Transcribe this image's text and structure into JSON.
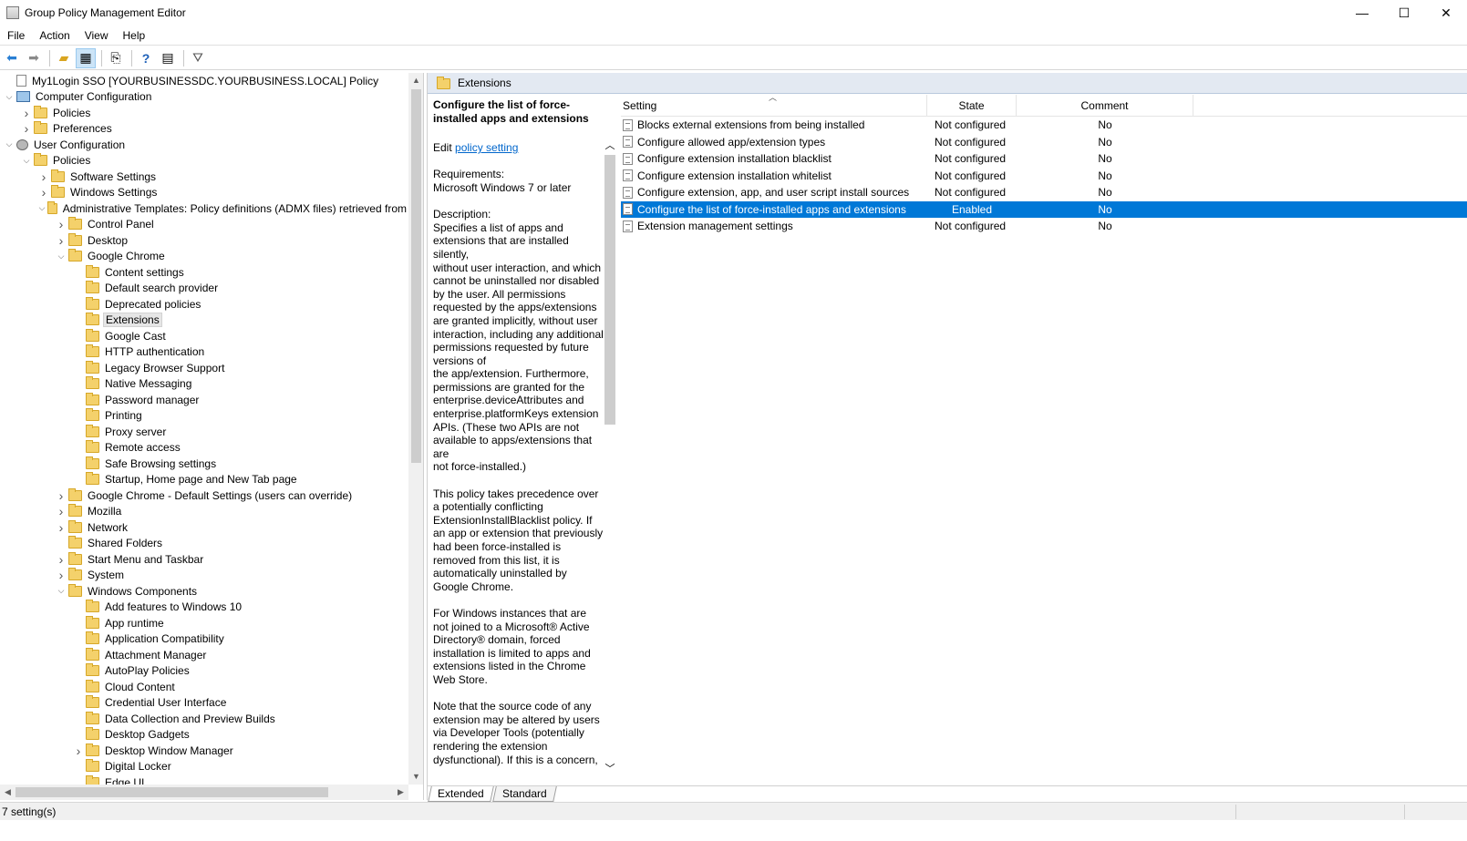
{
  "window": {
    "title": "Group Policy Management Editor",
    "minimize": "—",
    "maximize": "☐",
    "close": "✕"
  },
  "menu": [
    "File",
    "Action",
    "View",
    "Help"
  ],
  "tree": [
    {
      "depth": 0,
      "exp": "",
      "icon": "doc",
      "label": "My1Login SSO [YOURBUSINESSDC.YOURBUSINESS.LOCAL] Policy"
    },
    {
      "depth": 0,
      "exp": "down",
      "icon": "computer",
      "label": "Computer Configuration"
    },
    {
      "depth": 1,
      "exp": "right",
      "icon": "folder",
      "label": "Policies"
    },
    {
      "depth": 1,
      "exp": "right",
      "icon": "folder",
      "label": "Preferences"
    },
    {
      "depth": 0,
      "exp": "down",
      "icon": "user",
      "label": "User Configuration"
    },
    {
      "depth": 1,
      "exp": "down",
      "icon": "folder",
      "label": "Policies"
    },
    {
      "depth": 2,
      "exp": "right",
      "icon": "folder",
      "label": "Software Settings"
    },
    {
      "depth": 2,
      "exp": "right",
      "icon": "folder",
      "label": "Windows Settings"
    },
    {
      "depth": 2,
      "exp": "down",
      "icon": "folder",
      "label": "Administrative Templates: Policy definitions (ADMX files) retrieved from"
    },
    {
      "depth": 3,
      "exp": "right",
      "icon": "folder",
      "label": "Control Panel"
    },
    {
      "depth": 3,
      "exp": "right",
      "icon": "folder",
      "label": "Desktop"
    },
    {
      "depth": 3,
      "exp": "down",
      "icon": "folder",
      "label": "Google Chrome"
    },
    {
      "depth": 4,
      "exp": "",
      "icon": "folder",
      "label": "Content settings"
    },
    {
      "depth": 4,
      "exp": "",
      "icon": "folder",
      "label": "Default search provider"
    },
    {
      "depth": 4,
      "exp": "",
      "icon": "folder",
      "label": "Deprecated policies"
    },
    {
      "depth": 4,
      "exp": "",
      "icon": "folder",
      "label": "Extensions",
      "selected": true
    },
    {
      "depth": 4,
      "exp": "",
      "icon": "folder",
      "label": "Google Cast"
    },
    {
      "depth": 4,
      "exp": "",
      "icon": "folder",
      "label": "HTTP authentication"
    },
    {
      "depth": 4,
      "exp": "",
      "icon": "folder",
      "label": "Legacy Browser Support"
    },
    {
      "depth": 4,
      "exp": "",
      "icon": "folder",
      "label": "Native Messaging"
    },
    {
      "depth": 4,
      "exp": "",
      "icon": "folder",
      "label": "Password manager"
    },
    {
      "depth": 4,
      "exp": "",
      "icon": "folder",
      "label": "Printing"
    },
    {
      "depth": 4,
      "exp": "",
      "icon": "folder",
      "label": "Proxy server"
    },
    {
      "depth": 4,
      "exp": "",
      "icon": "folder",
      "label": "Remote access"
    },
    {
      "depth": 4,
      "exp": "",
      "icon": "folder",
      "label": "Safe Browsing settings"
    },
    {
      "depth": 4,
      "exp": "",
      "icon": "folder",
      "label": "Startup, Home page and New Tab page"
    },
    {
      "depth": 3,
      "exp": "right",
      "icon": "folder",
      "label": "Google Chrome - Default Settings (users can override)"
    },
    {
      "depth": 3,
      "exp": "right",
      "icon": "folder",
      "label": "Mozilla"
    },
    {
      "depth": 3,
      "exp": "right",
      "icon": "folder",
      "label": "Network"
    },
    {
      "depth": 3,
      "exp": "",
      "icon": "folder",
      "label": "Shared Folders"
    },
    {
      "depth": 3,
      "exp": "right",
      "icon": "folder",
      "label": "Start Menu and Taskbar"
    },
    {
      "depth": 3,
      "exp": "right",
      "icon": "folder",
      "label": "System"
    },
    {
      "depth": 3,
      "exp": "down",
      "icon": "folder",
      "label": "Windows Components"
    },
    {
      "depth": 4,
      "exp": "",
      "icon": "folder",
      "label": "Add features to Windows 10"
    },
    {
      "depth": 4,
      "exp": "",
      "icon": "folder",
      "label": "App runtime"
    },
    {
      "depth": 4,
      "exp": "",
      "icon": "folder",
      "label": "Application Compatibility"
    },
    {
      "depth": 4,
      "exp": "",
      "icon": "folder",
      "label": "Attachment Manager"
    },
    {
      "depth": 4,
      "exp": "",
      "icon": "folder",
      "label": "AutoPlay Policies"
    },
    {
      "depth": 4,
      "exp": "",
      "icon": "folder",
      "label": "Cloud Content"
    },
    {
      "depth": 4,
      "exp": "",
      "icon": "folder",
      "label": "Credential User Interface"
    },
    {
      "depth": 4,
      "exp": "",
      "icon": "folder",
      "label": "Data Collection and Preview Builds"
    },
    {
      "depth": 4,
      "exp": "",
      "icon": "folder",
      "label": "Desktop Gadgets"
    },
    {
      "depth": 4,
      "exp": "right",
      "icon": "folder",
      "label": "Desktop Window Manager"
    },
    {
      "depth": 4,
      "exp": "",
      "icon": "folder",
      "label": "Digital Locker"
    },
    {
      "depth": 4,
      "exp": "",
      "icon": "folder",
      "label": "Edge UI"
    }
  ],
  "right": {
    "header_title": "Extensions",
    "description": {
      "title": "Configure the list of force-installed apps and extensions",
      "edit_prefix": "Edit ",
      "edit_link": "policy setting ",
      "requirements": "Requirements:\nMicrosoft Windows 7 or later",
      "description": "Description:\nSpecifies a list of apps and extensions that are installed silently,\nwithout user interaction, and which cannot be uninstalled nor disabled by the user. All permissions requested by the apps/extensions are granted implicitly, without user interaction, including any additional permissions requested by future versions of\nthe app/extension. Furthermore, permissions are granted for the enterprise.deviceAttributes and enterprise.platformKeys extension APIs. (These two APIs are not available to apps/extensions that are\nnot force-installed.)",
      "p2": "This policy takes precedence over a potentially conflicting ExtensionInstallBlacklist policy. If an app or extension that previously had been force-installed is removed from this list, it is automatically uninstalled by Google Chrome.",
      "p3": "For Windows instances that are not joined to a Microsoft® Active Directory® domain, forced installation is limited to apps and extensions listed in the Chrome Web Store.",
      "p4": "Note that the source code of any extension may be altered by users via Developer Tools (potentially rendering the extension dysfunctional). If this is a concern,"
    },
    "columns": {
      "setting": "Setting",
      "state": "State",
      "comment": "Comment"
    },
    "rows": [
      {
        "setting": "Blocks external extensions from being installed",
        "state": "Not configured",
        "comment": "No"
      },
      {
        "setting": "Configure allowed app/extension types",
        "state": "Not configured",
        "comment": "No"
      },
      {
        "setting": "Configure extension installation blacklist",
        "state": "Not configured",
        "comment": "No"
      },
      {
        "setting": "Configure extension installation whitelist",
        "state": "Not configured",
        "comment": "No"
      },
      {
        "setting": "Configure extension, app, and user script install sources",
        "state": "Not configured",
        "comment": "No"
      },
      {
        "setting": "Configure the list of force-installed apps and extensions",
        "state": "Enabled",
        "comment": "No",
        "selected": true
      },
      {
        "setting": "Extension management settings",
        "state": "Not configured",
        "comment": "No"
      }
    ],
    "tabs": [
      "Extended",
      "Standard"
    ]
  },
  "status": {
    "text": "7 setting(s)"
  },
  "colors": {
    "selection": "#0078d7",
    "link": "#0066cc",
    "header_bg": "#e3e9f2"
  }
}
